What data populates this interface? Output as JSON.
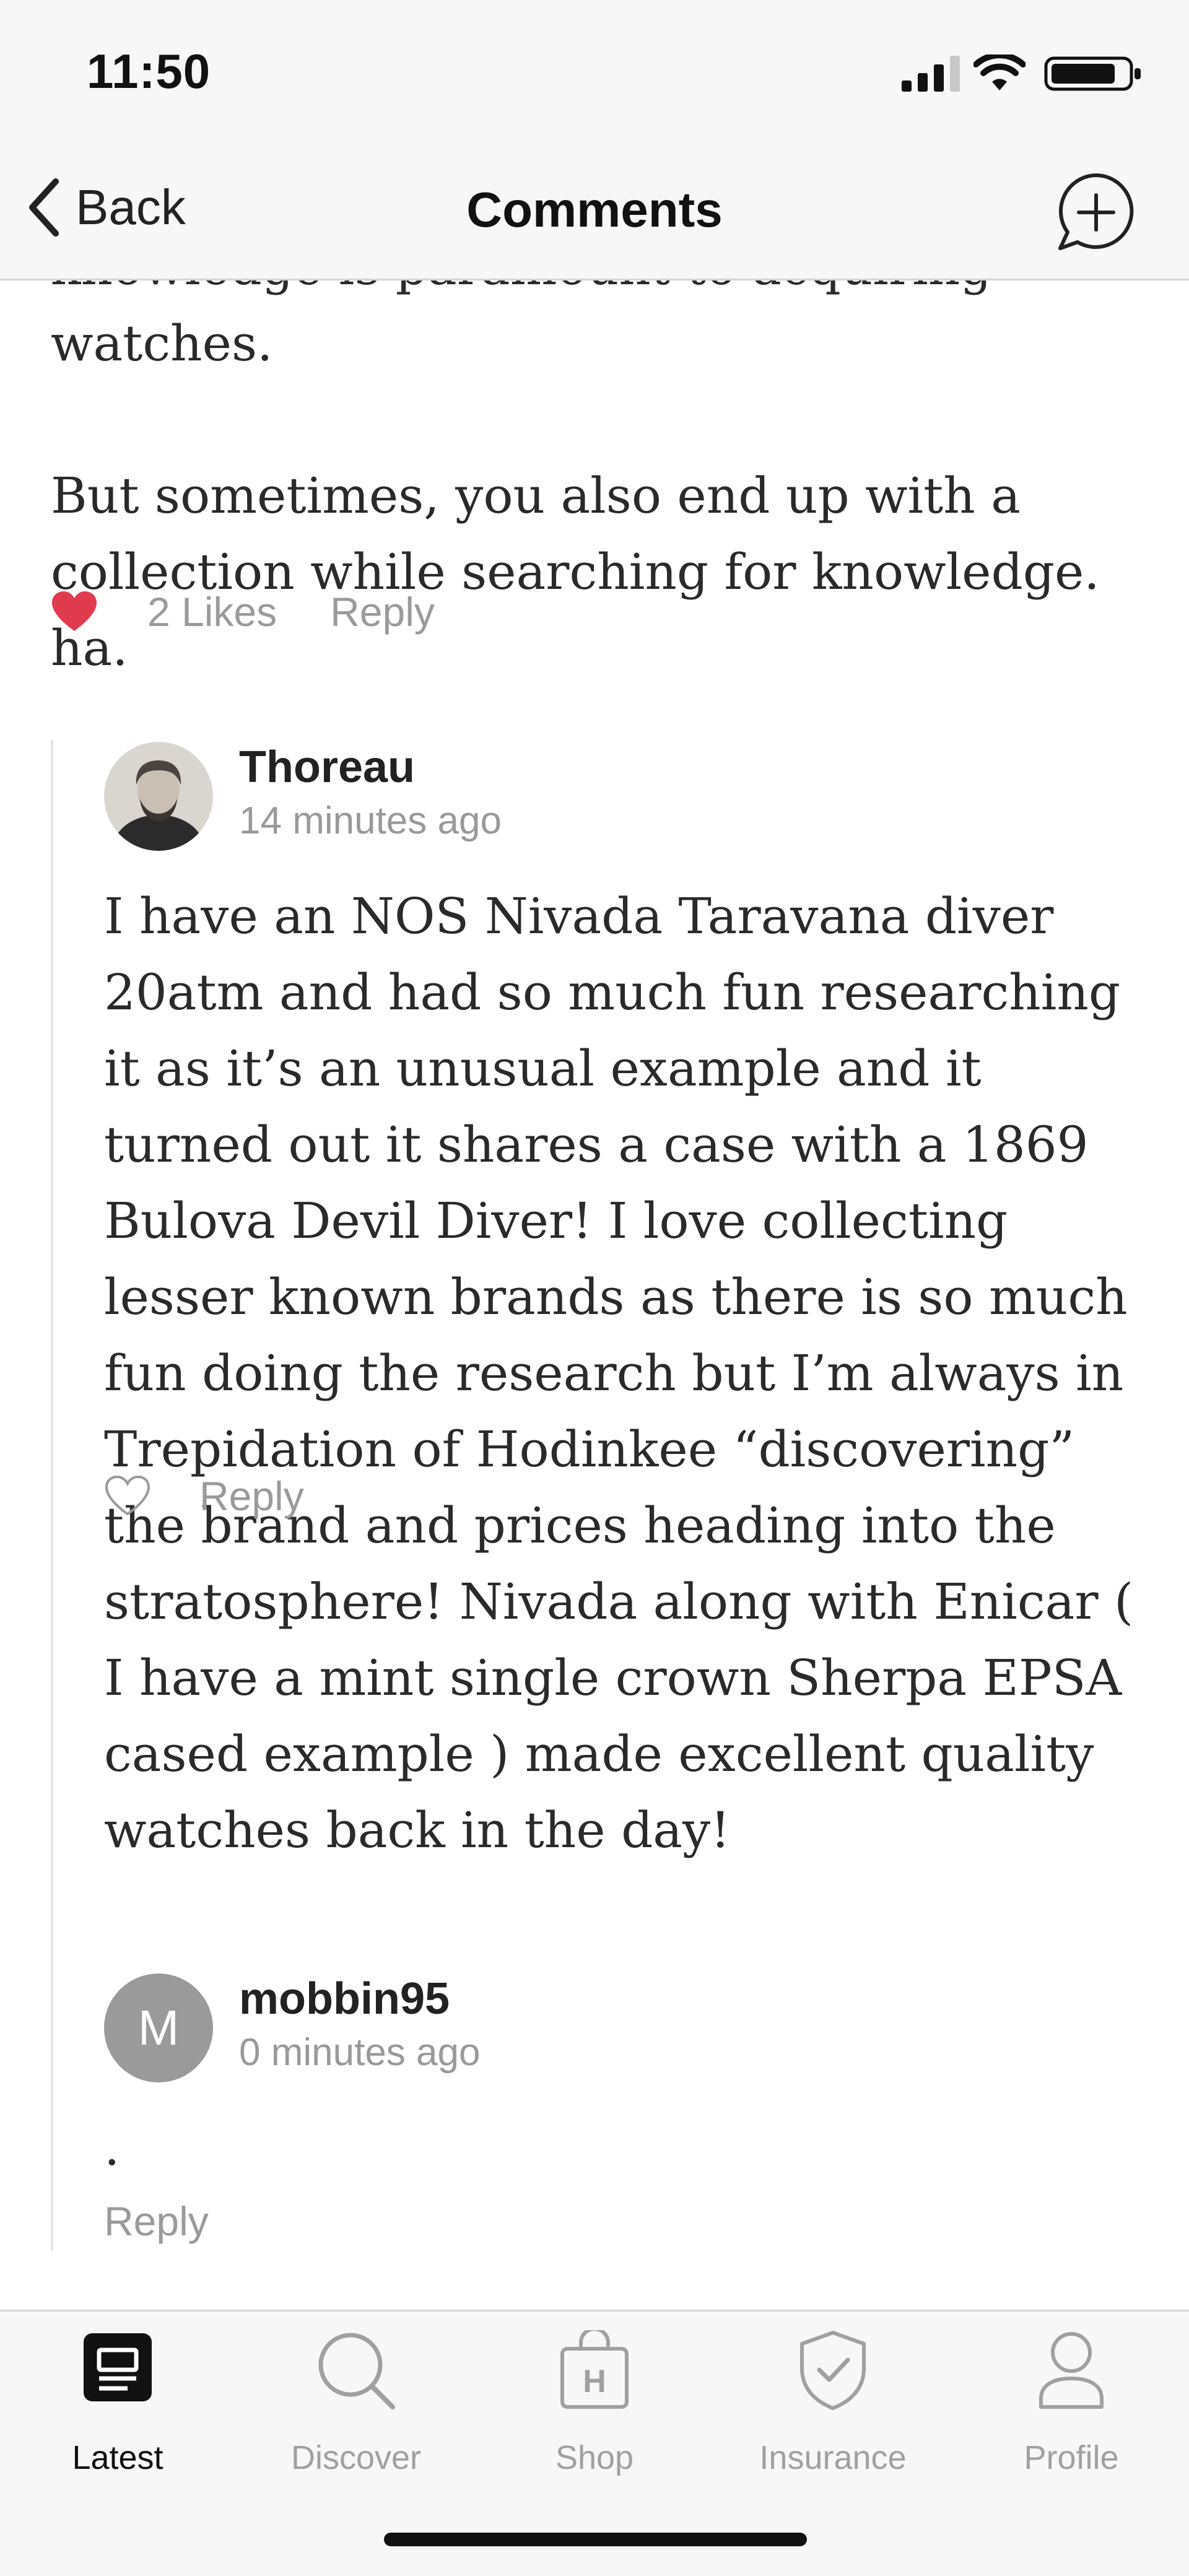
{
  "status_bar": {
    "time": "11:50"
  },
  "nav": {
    "back_label": "Back",
    "title": "Comments",
    "icons": {
      "back": "chevron-left-icon",
      "add_comment": "add-comment-bubble-icon"
    }
  },
  "top_comment": {
    "paragraph_1": "knowledge is paramount to acquiring watches.",
    "paragraph_2": "But sometimes, you also end up with a collection while searching for knowledge. ha.",
    "liked": true,
    "likes_label": "2 Likes",
    "reply_label": "Reply",
    "heart_color": "#e03a4e"
  },
  "replies": [
    {
      "author": "Thoreau",
      "time_ago": "14 minutes ago",
      "avatar": "portrait-avatar",
      "body": "I have an NOS Nivada Taravana diver 20atm and had so much fun researching it as it’s an unusual example and it turned out it shares a case with a 1869 Bulova Devil Diver! I love collecting lesser known brands as there is so much fun doing the research but I’m always in Trepidation of Hodinkee “discovering” the brand and prices heading into the stratosphere! Nivada along with Enicar ( I have a mint single crown Sherpa EPSA cased example ) made excellent quality watches back in the day!",
      "liked": false,
      "reply_label": "Reply"
    },
    {
      "author": "mobbin95",
      "time_ago": "0 minutes ago",
      "avatar_letter": "M",
      "body": ".",
      "reply_label": "Reply"
    }
  ],
  "tab_bar": {
    "tabs": [
      {
        "label": "Latest",
        "icon": "newspaper-icon",
        "active": true
      },
      {
        "label": "Discover",
        "icon": "search-icon",
        "active": false
      },
      {
        "label": "Shop",
        "icon": "shopping-bag-icon",
        "active": false
      },
      {
        "label": "Insurance",
        "icon": "shield-check-icon",
        "active": false
      },
      {
        "label": "Profile",
        "icon": "person-icon",
        "active": false
      }
    ]
  },
  "colors": {
    "accent_heart": "#e03a4e",
    "muted_text": "#9a9a9a",
    "bar_background": "#f7f7f7"
  }
}
